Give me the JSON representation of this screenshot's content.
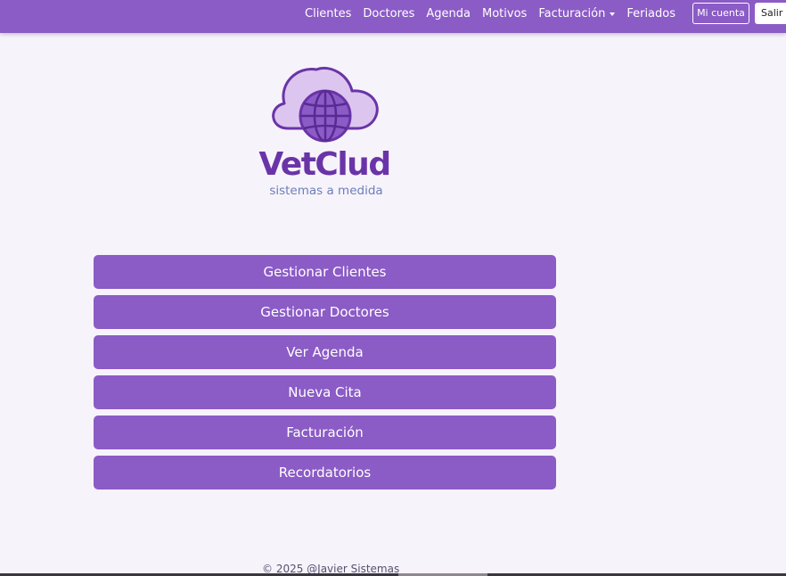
{
  "nav": {
    "links": [
      "Clientes",
      "Doctores",
      "Agenda",
      "Motivos",
      "Facturación",
      "Feriados"
    ],
    "account_label": "Mi cuenta",
    "logout_label": "Salir"
  },
  "logo": {
    "name": "VetClud",
    "tagline": "sistemas a medida"
  },
  "menu": {
    "buttons": [
      "Gestionar Clientes",
      "Gestionar Doctores",
      "Ver Agenda",
      "Nueva Cita",
      "Facturación",
      "Recordatorios"
    ]
  },
  "footer": {
    "text": "© 2025 @Javier Sistemas"
  },
  "colors": {
    "brand": "#8b5bc6",
    "background": "#f7f3fb",
    "logo_text": "#6a34a8",
    "logo_tagline": "#6a7fb8"
  }
}
